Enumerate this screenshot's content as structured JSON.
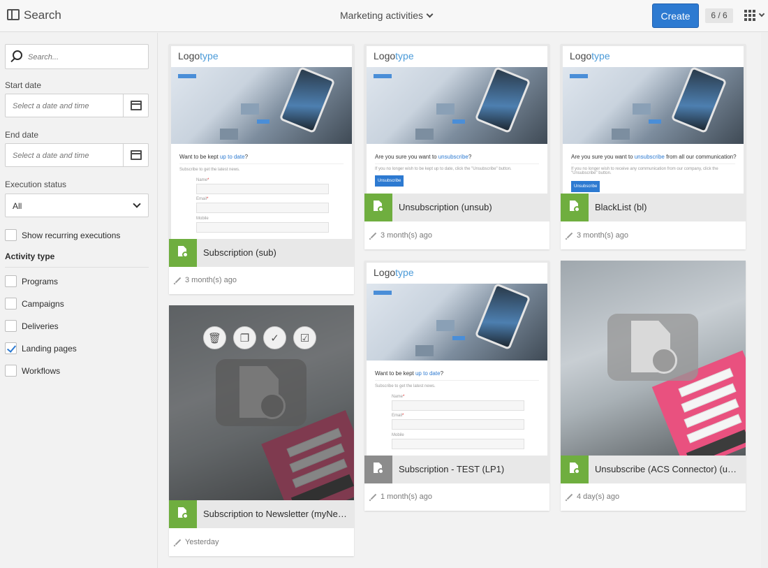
{
  "header": {
    "search_title": "Search",
    "context_label": "Marketing activities",
    "create_label": "Create",
    "count": "6 / 6"
  },
  "filters": {
    "search_placeholder": "Search...",
    "start_date_label": "Start date",
    "start_date_placeholder": "Select a date and time",
    "end_date_label": "End date",
    "end_date_placeholder": "Select a date and time",
    "execution_status_label": "Execution status",
    "execution_status_value": "All",
    "recurring_label": "Show recurring executions",
    "recurring_checked": false,
    "activity_type_title": "Activity type",
    "activity_types": [
      {
        "label": "Programs",
        "checked": false
      },
      {
        "label": "Campaigns",
        "checked": false
      },
      {
        "label": "Deliveries",
        "checked": false
      },
      {
        "label": "Landing pages",
        "checked": true
      },
      {
        "label": "Workflows",
        "checked": false
      }
    ]
  },
  "colors": {
    "accent": "#2d7ad1",
    "landing_page_green": "#6fae3f",
    "draft_grey": "#8c8c8c"
  },
  "preview": {
    "logo_a": "Logo",
    "logo_b": "type",
    "subscribe_title_a": "Want to be kept ",
    "subscribe_title_hl": "up to date",
    "subscribe_title_b": "?",
    "subscribe_sub": "Subscribe to get the latest news.",
    "field_name": "Name",
    "field_email": "Email",
    "field_mobile": "Mobile",
    "unsub_title_a": "Are you sure you want to ",
    "unsub_title_hl": "unsubscribe",
    "unsub_title_b": "?",
    "unsub_text": "If you no longer wish to be kept up to date, click the \"Unsubscribe\" button.",
    "blacklist_title_b": " from all our communication?",
    "blacklist_text": "If you no longer wish to receive any communication from our company, click the \"Unsubscribe\" button.",
    "unsub_button": "Unsubscribe"
  },
  "cards": [
    {
      "name": "Subscription (sub)",
      "modified": "3 month(s) ago",
      "icon": "landing-page-icon",
      "status": "published"
    },
    {
      "name": "Unsubscription (unsub)",
      "modified": "3 month(s) ago",
      "icon": "landing-page-icon",
      "status": "published"
    },
    {
      "name": "BlackList (bl)",
      "modified": "3 month(s) ago",
      "icon": "landing-page-icon",
      "status": "published"
    },
    {
      "name": "Subscription to Newsletter (myNewsletter)",
      "modified": "Yesterday",
      "icon": "landing-page-icon",
      "status": "published"
    },
    {
      "name": "Subscription - TEST (LP1)",
      "modified": "1 month(s) ago",
      "icon": "landing-page-icon",
      "status": "draft"
    },
    {
      "name": "Unsubscribe (ACS Connector) (unsubscribe)",
      "modified": "4 day(s) ago",
      "icon": "landing-page-icon",
      "status": "published"
    }
  ],
  "card_actions": [
    {
      "name": "delete",
      "icon": "trash-icon",
      "glyph": "🗑"
    },
    {
      "name": "duplicate",
      "icon": "duplicate-icon",
      "glyph": "❐"
    },
    {
      "name": "approve",
      "icon": "check-icon",
      "glyph": "✓"
    },
    {
      "name": "select",
      "icon": "checkbox-icon",
      "glyph": "☑"
    }
  ]
}
